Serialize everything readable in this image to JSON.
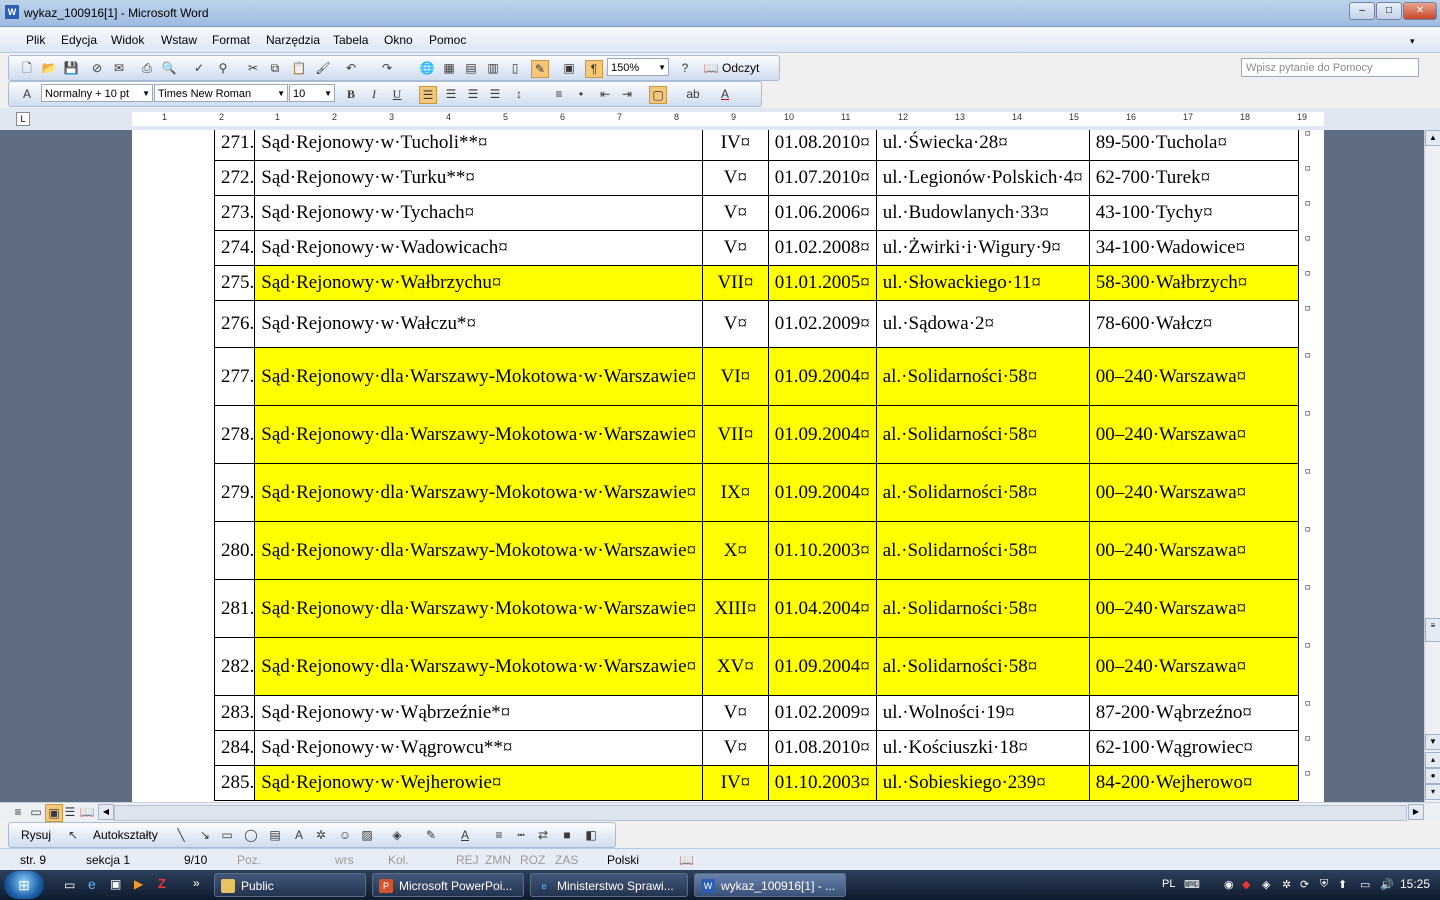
{
  "window": {
    "title": "wykaz_100916[1] - Microsoft Word",
    "app_icon": "W",
    "minimize": "–",
    "maximize": "□",
    "close": "✕"
  },
  "menu": {
    "items": [
      "Plik",
      "Edycja",
      "Widok",
      "Wstaw",
      "Format",
      "Narzędzia",
      "Tabela",
      "Okno",
      "Pomoc"
    ],
    "help_placeholder": "Wpisz pytanie do Pomocy"
  },
  "toolbar": {
    "zoom": "150%",
    "read_label": "Odczyt"
  },
  "format_bar": {
    "style": "Normalny + 10 pt",
    "font": "Times New Roman",
    "size": "10"
  },
  "ruler": {
    "ticks": [
      "1",
      "2",
      "1",
      "1",
      "2",
      "3",
      "4",
      "5",
      "6",
      "7",
      "8",
      "9",
      "10",
      "11",
      "12",
      "13",
      "14",
      "15",
      "16",
      "17",
      "18",
      "19"
    ]
  },
  "table": {
    "end_mark": "¤",
    "rows": [
      {
        "nr": "271.",
        "name": "Sąd·Rejonowy·w·Tucholi**¤",
        "inst": "IV¤",
        "date": "01.08.2010¤",
        "addr": "ul.·Świecka·28¤",
        "city": "89-500·Tuchola¤",
        "highlight": false
      },
      {
        "nr": "272.",
        "name": "Sąd·Rejonowy·w·Turku**¤",
        "inst": "V¤",
        "date": "01.07.2010¤",
        "addr": "ul.·Legionów·Polskich·4¤",
        "city": "62-700·Turek¤",
        "highlight": false
      },
      {
        "nr": "273.",
        "name": "Sąd·Rejonowy·w·Tychach¤",
        "inst": "V¤",
        "date": "01.06.2006¤",
        "addr": "ul.·Budowlanych·33¤",
        "city": "43-100·Tychy¤",
        "highlight": false
      },
      {
        "nr": "274.",
        "name": "Sąd·Rejonowy·w·Wadowicach¤",
        "inst": "V¤",
        "date": "01.02.2008¤",
        "addr": "ul.·Żwirki·i·Wigury·9¤",
        "city": "34-100·Wadowice¤",
        "highlight": false
      },
      {
        "nr": "275.",
        "name": "Sąd·Rejonowy·w·Wałbrzychu¤",
        "inst": "VII¤",
        "date": "01.01.2005¤",
        "addr": "ul.·Słowackiego·11¤",
        "city": "58-300·Wałbrzych¤",
        "highlight": true
      },
      {
        "nr": "276.",
        "name": "Sąd·Rejonowy·w·Wałczu*¤",
        "inst": "V¤",
        "date": "01.02.2009¤",
        "addr": "ul.·Sądowa·2¤",
        "city": "78-600·Wałcz¤",
        "highlight": false
      },
      {
        "nr": "277.",
        "name": "Sąd·Rejonowy·dla·Warszawy-Mokotowa·w·Warszawie¤",
        "inst": "VI¤",
        "date": "01.09.2004¤",
        "addr": "al.·Solidarności·58¤",
        "city": "00–240·Warszawa¤",
        "highlight": true
      },
      {
        "nr": "278.",
        "name": "Sąd·Rejonowy·dla·Warszawy-Mokotowa·w·Warszawie¤",
        "inst": "VII¤",
        "date": "01.09.2004¤",
        "addr": "al.·Solidarności·58¤",
        "city": "00–240·Warszawa¤",
        "highlight": true
      },
      {
        "nr": "279.",
        "name": "Sąd·Rejonowy·dla·Warszawy-Mokotowa·w·Warszawie¤",
        "inst": "IX¤",
        "date": "01.09.2004¤",
        "addr": "al.·Solidarności·58¤",
        "city": "00–240·Warszawa¤",
        "highlight": true
      },
      {
        "nr": "280.",
        "name": "Sąd·Rejonowy·dla·Warszawy-Mokotowa·w·Warszawie¤",
        "inst": "X¤",
        "date": "01.10.2003¤",
        "addr": "al.·Solidarności·58¤",
        "city": "00–240·Warszawa¤",
        "highlight": true
      },
      {
        "nr": "281.",
        "name": "Sąd·Rejonowy·dla·Warszawy·Mokotowa·w·Warszawie¤",
        "inst": "XIII¤",
        "date": "01.04.2004¤",
        "addr": "al.·Solidarności·58¤",
        "city": "00–240·Warszawa¤",
        "highlight": true
      },
      {
        "nr": "282.",
        "name": "Sąd·Rejonowy·dla·Warszawy-Mokotowa·w·Warszawie¤",
        "inst": "XV¤",
        "date": "01.09.2004¤",
        "addr": "al.·Solidarności·58¤",
        "city": "00–240·Warszawa¤",
        "highlight": true
      },
      {
        "nr": "283.",
        "name": "Sąd·Rejonowy·w·Wąbrzeźnie*¤",
        "inst": "V¤",
        "date": "01.02.2009¤",
        "addr": "ul.·Wolności·19¤",
        "city": "87-200·Wąbrzeźno¤",
        "highlight": false
      },
      {
        "nr": "284.",
        "name": "Sąd·Rejonowy·w·Wągrowcu**¤",
        "inst": "V¤",
        "date": "01.08.2010¤",
        "addr": "ul.·Kościuszki·18¤",
        "city": "62-100·Wągrowiec¤",
        "highlight": false
      },
      {
        "nr": "285.",
        "name": "Sąd·Rejonowy·w·Wejherowie¤",
        "inst": "IV¤",
        "date": "01.10.2003¤",
        "addr": "ul.·Sobieskiego·239¤",
        "city": "84-200·Wejherowo¤",
        "highlight": true
      }
    ]
  },
  "draw_bar": {
    "draw_label": "Rysuj",
    "autoshapes_label": "Autokształty"
  },
  "status": {
    "page": "str. 9",
    "section": "sekcja 1",
    "pages": "9/10",
    "pos": "Poz.",
    "line": "wrs",
    "col": "Kol.",
    "rec": "REJ",
    "trk": "ZMN",
    "ext": "ROZ",
    "ovr": "ZAS",
    "lang": "Polski"
  },
  "taskbar": {
    "buttons": [
      {
        "label": "Public",
        "icon": "folder-icon"
      },
      {
        "label": "Microsoft PowerPoi...",
        "icon": "powerpoint-icon"
      },
      {
        "label": "Ministerstwo Sprawi...",
        "icon": "ie-icon"
      },
      {
        "label": "wykaz_100916[1] - ...",
        "icon": "word-icon"
      }
    ],
    "lang": "PL",
    "clock": "15:25"
  },
  "colors": {
    "highlight": "#ffff00",
    "doc_background": "#5f6d82"
  }
}
